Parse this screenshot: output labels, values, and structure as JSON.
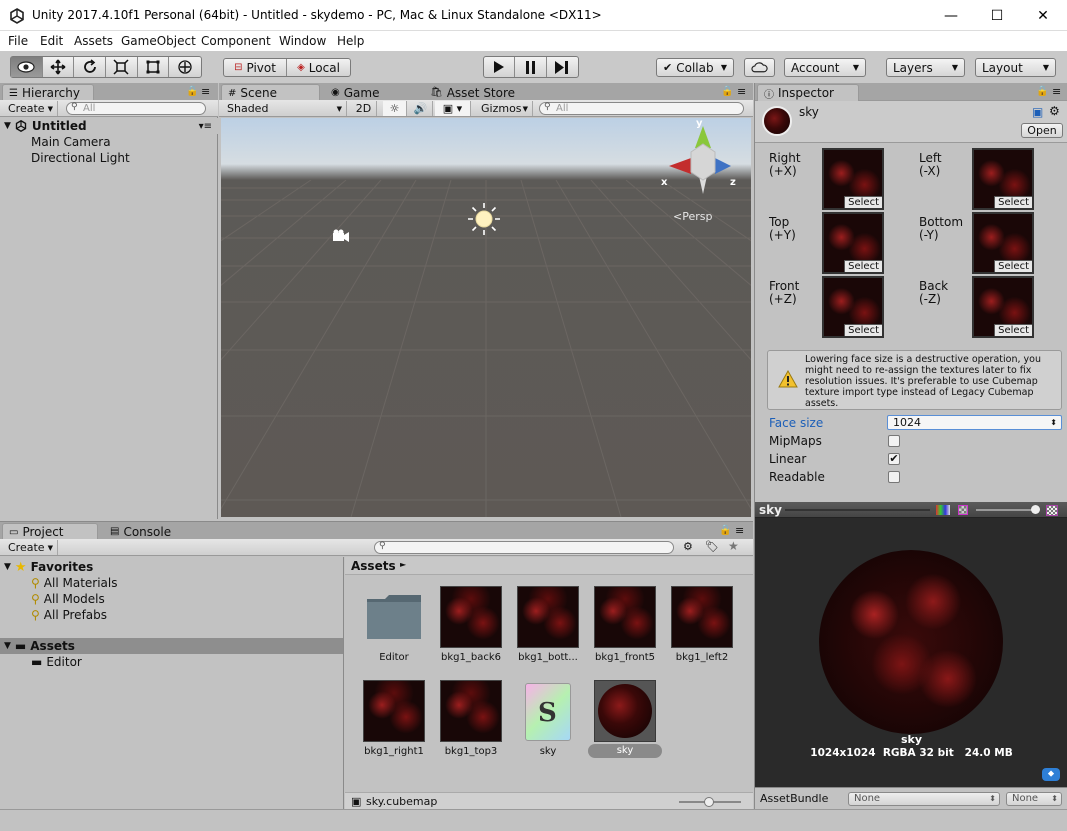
{
  "window": {
    "title": "Unity 2017.4.10f1 Personal (64bit) - Untitled - skydemo - PC, Mac & Linux Standalone <DX11>",
    "minimize": "—",
    "maximize": "☐",
    "close": "✕"
  },
  "menu": [
    "File",
    "Edit",
    "Assets",
    "GameObject",
    "Component",
    "Window",
    "Help"
  ],
  "toolbar": {
    "tools": [
      "hand-view-icon",
      "move-icon",
      "rotate-icon",
      "scale-icon",
      "rect-icon",
      "transform-icon"
    ],
    "pivot": "Pivot",
    "local": "Local",
    "collab": "Collab",
    "account": "Account",
    "layers": "Layers",
    "layout": "Layout"
  },
  "hierarchy": {
    "tab": "Hierarchy",
    "create": "Create",
    "search_placeholder": "All",
    "scene": "Untitled",
    "items": [
      "Main Camera",
      "Directional Light"
    ]
  },
  "scene": {
    "tabs": [
      "Scene",
      "Game",
      "Asset Store"
    ],
    "shading": "Shaded",
    "mode2d": "2D",
    "gizmos": "Gizmos",
    "search_placeholder": "All",
    "persp": "Persp",
    "axis_y": "y",
    "axis_x": "x",
    "axis_z": "z"
  },
  "inspector": {
    "tab": "Inspector",
    "asset_name": "sky",
    "open": "Open",
    "faces": [
      {
        "name": "Right",
        "axis": "(+X)"
      },
      {
        "name": "Left",
        "axis": "(-X)"
      },
      {
        "name": "Top",
        "axis": "(+Y)"
      },
      {
        "name": "Bottom",
        "axis": "(-Y)"
      },
      {
        "name": "Front",
        "axis": "(+Z)"
      },
      {
        "name": "Back",
        "axis": "(-Z)"
      }
    ],
    "select": "Select",
    "warning": "Lowering face size is a destructive operation, you might need to re-assign the textures later to fix resolution issues. It's preferable to use Cubemap texture import type instead of Legacy Cubemap assets.",
    "props": {
      "face_size_label": "Face size",
      "face_size_value": "1024",
      "mipmaps_label": "MipMaps",
      "mipmaps": false,
      "linear_label": "Linear",
      "linear": true,
      "readable_label": "Readable",
      "readable": false
    }
  },
  "preview": {
    "title": "sky",
    "name": "sky",
    "info": "1024x1024  RGBA 32 bit   24.0 MB",
    "assetbundle_label": "AssetBundle",
    "bundle_name": "None",
    "bundle_variant": "None"
  },
  "project": {
    "tabs": [
      "Project",
      "Console"
    ],
    "create": "Create",
    "favorites": "Favorites",
    "fav_items": [
      "All Materials",
      "All Models",
      "All Prefabs"
    ],
    "assets_root": "Assets",
    "assets_children": [
      "Editor"
    ],
    "breadcrumb": "Assets",
    "assets": [
      {
        "label": "Editor",
        "kind": "folder"
      },
      {
        "label": "bkg1_back6",
        "kind": "texture"
      },
      {
        "label": "bkg1_bott...",
        "kind": "texture"
      },
      {
        "label": "bkg1_front5",
        "kind": "texture"
      },
      {
        "label": "bkg1_left2",
        "kind": "texture"
      },
      {
        "label": "bkg1_right1",
        "kind": "texture"
      },
      {
        "label": "bkg1_top3",
        "kind": "texture"
      },
      {
        "label": "sky",
        "kind": "shader"
      },
      {
        "label": "sky",
        "kind": "cubemap"
      }
    ],
    "selected_path": "sky.cubemap"
  }
}
